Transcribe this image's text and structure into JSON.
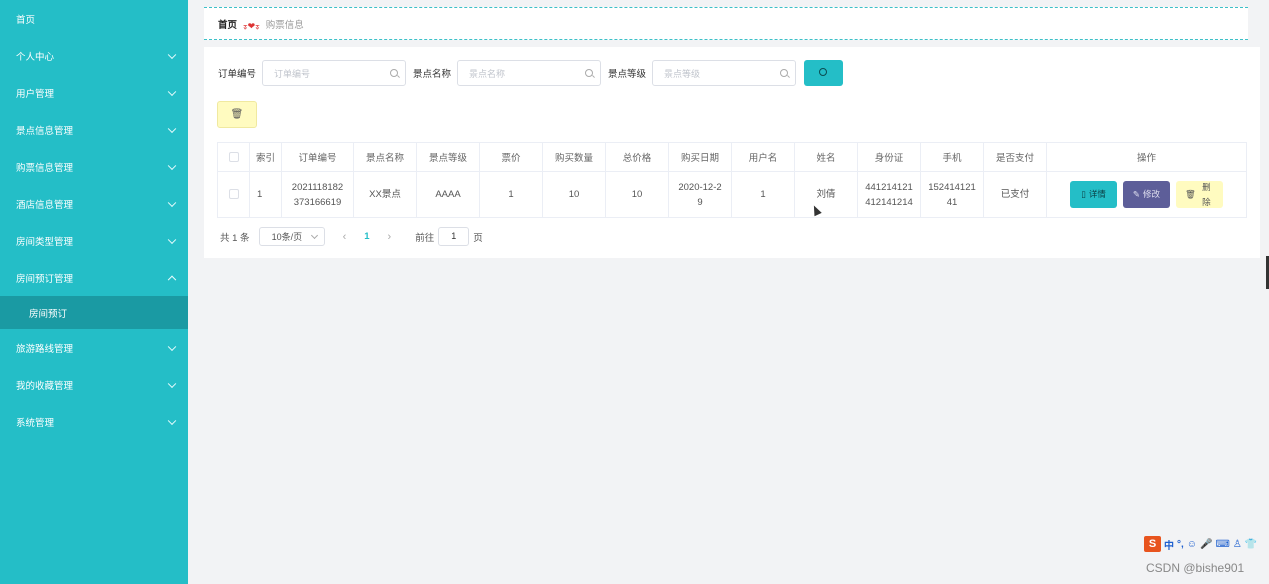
{
  "sidebar": {
    "items": [
      {
        "label": "首页"
      },
      {
        "label": "个人中心"
      },
      {
        "label": "用户管理"
      },
      {
        "label": "景点信息管理"
      },
      {
        "label": "购票信息管理"
      },
      {
        "label": "酒店信息管理"
      },
      {
        "label": "房间类型管理"
      },
      {
        "label": "房间预订管理"
      },
      {
        "label": "房间预订"
      },
      {
        "label": "旅游路线管理"
      },
      {
        "label": "我的收藏管理"
      },
      {
        "label": "系统管理"
      }
    ]
  },
  "breadcrumb": {
    "home": "首页",
    "separator": "ᢌ❤ᢌ",
    "current": "购票信息"
  },
  "search": {
    "order_no_label": "订单编号",
    "order_no_placeholder": "订单编号",
    "spot_name_label": "景点名称",
    "spot_name_placeholder": "景点名称",
    "spot_level_label": "景点等级",
    "spot_level_placeholder": "景点等级"
  },
  "toolbar": {
    "delete_icon": "trash-icon"
  },
  "table": {
    "headers": [
      "",
      "索引",
      "订单编号",
      "景点名称",
      "景点等级",
      "票价",
      "购买数量",
      "总价格",
      "购买日期",
      "用户名",
      "姓名",
      "身份证",
      "手机",
      "是否支付",
      "操作"
    ],
    "rows": [
      {
        "index": "1",
        "order_no_1": "2021118182",
        "order_no_2": "373166619",
        "spot_name": "XX景点",
        "spot_level": "AAAA",
        "price": "1",
        "quantity": "10",
        "total": "10",
        "date_1": "2020-12-2",
        "date_2": "9",
        "username": "1",
        "name": "刘倩",
        "id_card_1": "441214121",
        "id_card_2": "412141214",
        "phone_1": "152414121",
        "phone_2": "41",
        "paid": "已支付",
        "detail_label": "详情",
        "edit_label": "修改",
        "delete_label": "删除"
      }
    ]
  },
  "pagination": {
    "total": "共 1 条",
    "page_size": "10条/页",
    "current_page": "1",
    "goto_label": "前往",
    "goto_value": "1",
    "page_suffix": "页"
  },
  "tray": {
    "logo": "S",
    "lang": "中"
  },
  "watermark": "CSDN @bishe901",
  "colors": {
    "accent": "#24bec7",
    "sidebar_active": "#1a9aa3",
    "edit_button": "#5d5e99",
    "delete_button": "#fffbc0"
  }
}
